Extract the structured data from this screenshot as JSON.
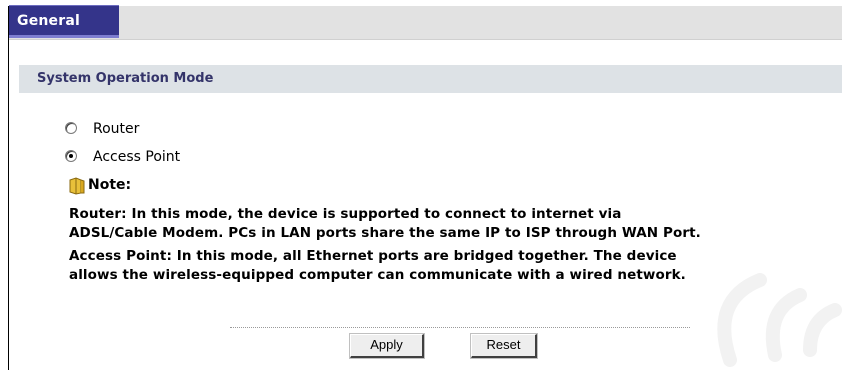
{
  "tabs": [
    {
      "label": "General",
      "active": true
    }
  ],
  "section": {
    "title": "System Operation Mode"
  },
  "mode_options": [
    {
      "label": "Router",
      "checked": false
    },
    {
      "label": "Access Point",
      "checked": true
    }
  ],
  "note": {
    "label": "Note:",
    "icon": "note-icon",
    "lines": [
      "Router: In this mode, the device is supported to connect to internet via",
      "ADSL/Cable Modem. PCs in LAN ports share the same IP to ISP through WAN Port.",
      "Access Point: In this mode, all Ethernet ports are bridged together. The device",
      "allows the wireless-equipped computer can communicate with a wired network."
    ]
  },
  "buttons": {
    "apply": "Apply",
    "reset": "Reset"
  },
  "colors": {
    "tab_active": "#34348a",
    "section_header_bg": "#dde2e6",
    "section_title": "#34346a"
  }
}
